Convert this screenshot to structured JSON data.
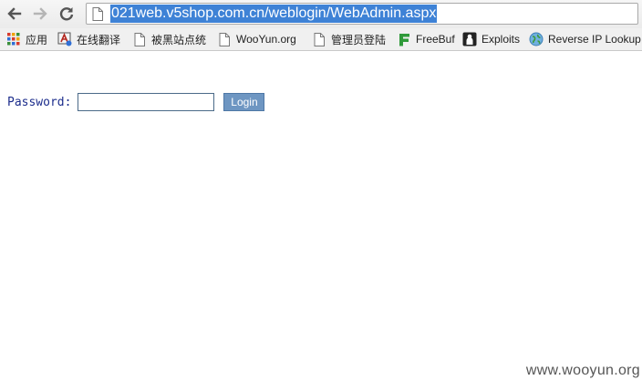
{
  "browser": {
    "url": "021web.v5shop.com.cn/weblogin/WebAdmin.aspx"
  },
  "bookmarks": [
    {
      "label": "应用",
      "icon": "apps-grid-icon"
    },
    {
      "label": "在线翻译",
      "icon": "translate-icon"
    },
    {
      "label": "被黑站点统",
      "icon": "page-icon"
    },
    {
      "label": "WooYun.org",
      "icon": "page-icon"
    },
    {
      "label": "管理员登陆",
      "icon": "page-icon"
    },
    {
      "label": "FreeBuf",
      "icon": "freebuf-icon"
    },
    {
      "label": "Exploits",
      "icon": "exploits-icon"
    },
    {
      "label": "Reverse IP Lookup",
      "icon": "globe-icon"
    }
  ],
  "form": {
    "password_label": "Password:",
    "password_value": "",
    "login_label": "Login"
  },
  "watermark": "www.wooyun.org"
}
